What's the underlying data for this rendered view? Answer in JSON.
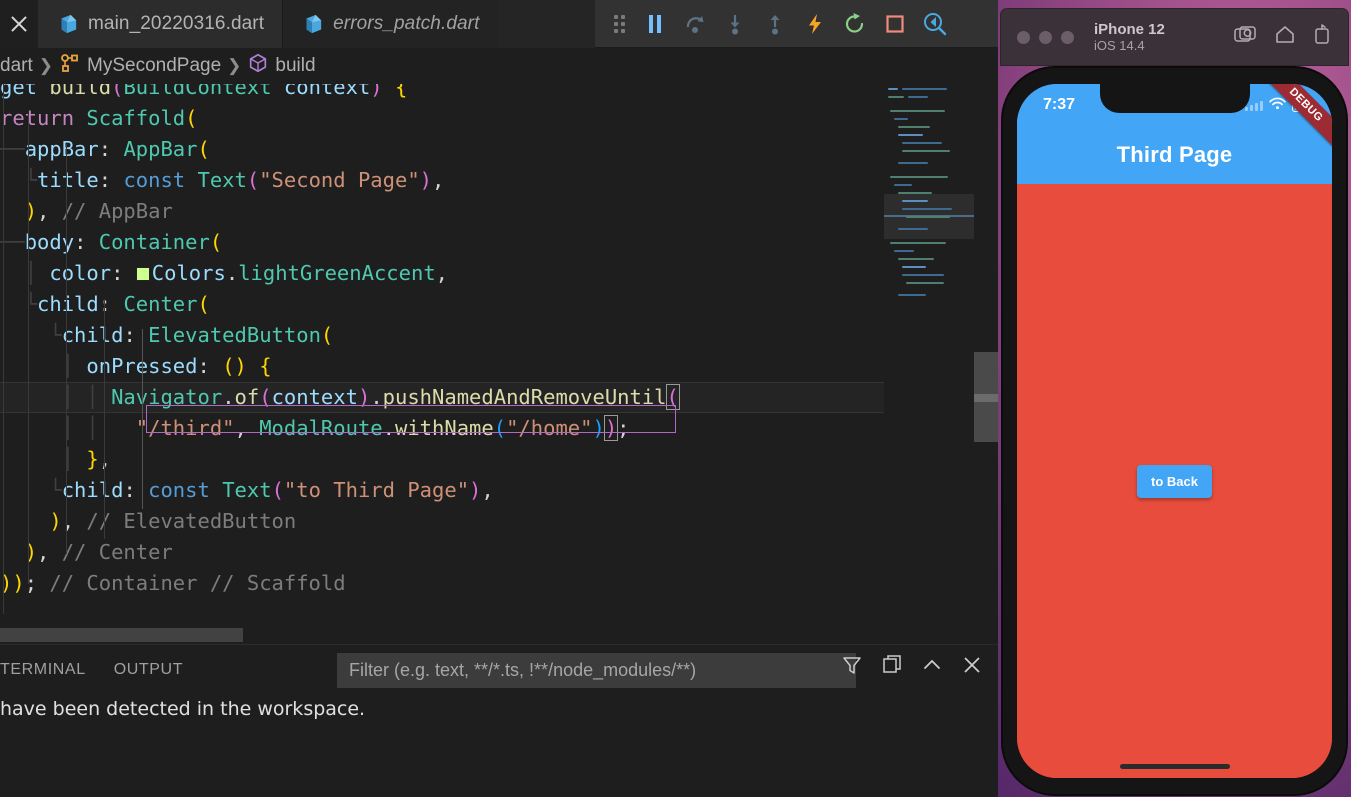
{
  "editor": {
    "tabs": [
      {
        "label": "main_20220316.dart",
        "active": true,
        "icon": "dart-icon"
      },
      {
        "label": "errors_patch.dart",
        "active": false,
        "icon": "dart-icon"
      }
    ],
    "close_icon": "close-icon",
    "breadcrumb": [
      {
        "label": "dart",
        "icon": "file-icon"
      },
      {
        "label": "MySecondPage",
        "icon": "class-icon"
      },
      {
        "label": "build",
        "icon": "method-icon"
      }
    ],
    "code_lines": [
      "get build(BuildContext context) {",
      "return Scaffold(",
      "appBar: AppBar(",
      "title: const Text(\"Second Page\"),",
      "), // AppBar",
      "body: Container(",
      "color: Colors.lightGreenAccent,",
      "child: Center(",
      "child: ElevatedButton(",
      "onPressed: () {",
      "Navigator.of(context).pushNamedAndRemoveUntil(",
      "\"/third\", ModalRoute.withName(\"/home\"));",
      "},",
      "child: const Text(\"to Third Page\"),",
      "), // ElevatedButton",
      "), // Center",
      ")); // Container // Scaffold"
    ],
    "colors": {
      "background": "#1e1e1e",
      "keyword": "#C586C0",
      "type": "#4EC9B0",
      "property": "#9CDCFE",
      "function": "#DCDCAA",
      "string": "#CE9178",
      "comment": "#7d7d7d",
      "control": "#569CD6",
      "bracket_yellow": "#FFD700",
      "bracket_pink": "#DA70D6",
      "swatch_lightGreenAccent": "#CCFF90"
    }
  },
  "debug_toolbar": {
    "buttons": [
      {
        "name": "drag-handle",
        "label": "Drag"
      },
      {
        "name": "pause-button",
        "label": "Pause"
      },
      {
        "name": "step-over-button",
        "label": "Step Over"
      },
      {
        "name": "step-into-button",
        "label": "Step Into"
      },
      {
        "name": "step-out-button",
        "label": "Step Out"
      },
      {
        "name": "hot-reload-button",
        "label": "Hot Reload"
      },
      {
        "name": "hot-restart-button",
        "label": "Hot Restart"
      },
      {
        "name": "stop-button",
        "label": "Stop"
      },
      {
        "name": "devtools-button",
        "label": "Open DevTools"
      }
    ]
  },
  "panel": {
    "tabs": [
      "TERMINAL",
      "OUTPUT"
    ],
    "filter_placeholder": "Filter (e.g. text, **/*.ts, !**/node_modules/**)",
    "filter_value": "",
    "actions": [
      "filter-icon",
      "clear-output-icon",
      "collapse-icon",
      "close-icon"
    ],
    "output_text": "have been detected in the workspace."
  },
  "simulator": {
    "window_title": "iPhone 12",
    "window_subtitle": "iOS 14.4",
    "toolbar_icons": [
      "screenshot-icon",
      "home-icon",
      "rotate-icon"
    ],
    "status_time": "7:37",
    "app_bar_title": "Third Page",
    "button_label": "to Back",
    "debug_banner": "DEBUG",
    "colors": {
      "app_bar": "#42A5F5",
      "body": "#E74C3C",
      "button": "#42A5F5",
      "banner": "#9c2b34"
    }
  }
}
